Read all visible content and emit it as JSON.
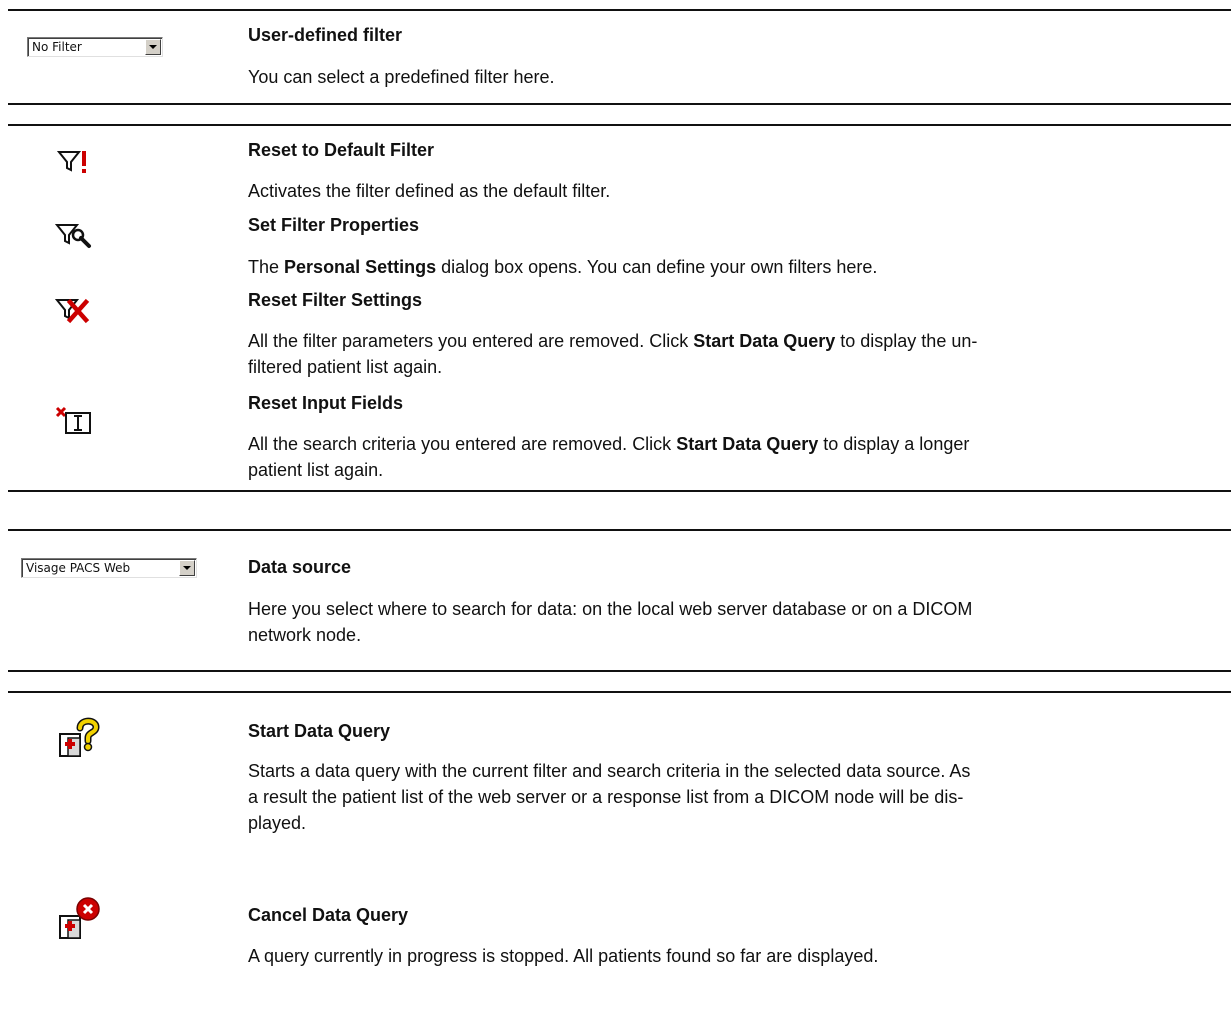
{
  "user_filter": {
    "combo_value": "No Filter",
    "title": "User-defined filter",
    "desc": "You can select a predefined filter here."
  },
  "reset_default": {
    "icon": "filter-exclamation-icon",
    "title": "Reset to Default Filter",
    "desc": "Activates the filter defined as the default filter."
  },
  "set_props": {
    "icon": "filter-wrench-icon",
    "title": "Set Filter Properties",
    "desc_prefix": "The ",
    "desc_bold": "Personal Settings",
    "desc_suffix": " dialog box opens. You can define your own filters here."
  },
  "reset_filter": {
    "icon": "filter-red-x-icon",
    "title": "Reset Filter Settings",
    "desc_prefix": "All the filter parameters you entered are removed. Click ",
    "desc_bold": "Start Data Query",
    "desc_line1_suffix": " to display the un-",
    "desc_line2": "filtered patient list again."
  },
  "reset_input": {
    "icon": "input-field-red-x-icon",
    "title": "Reset Input Fields",
    "desc_prefix": "All the search criteria you entered are removed. Click ",
    "desc_bold": "Start Data Query",
    "desc_line1_suffix": " to display a longer",
    "desc_line2": "patient list again."
  },
  "data_source": {
    "combo_value": "Visage PACS Web",
    "title": "Data source",
    "desc_line1": "Here you select where to search for data: on the local web server database or on a DICOM",
    "desc_line2": "network node."
  },
  "start_query": {
    "icon": "patient-query-question-icon",
    "title": "Start Data Query",
    "desc_line1": "Starts a data query with the current filter and search criteria in the selected data source. As",
    "desc_line2": "a result the patient list of the web server or a response list from a DICOM node will be dis-",
    "desc_line3": "played."
  },
  "cancel_query": {
    "icon": "patient-query-cancel-icon",
    "title": "Cancel Data Query",
    "desc": "A query currently in progress is stopped. All patients found so far are displayed."
  },
  "colors": {
    "red": "#cc0000",
    "yellow": "#f2d200",
    "text": "#111111"
  }
}
